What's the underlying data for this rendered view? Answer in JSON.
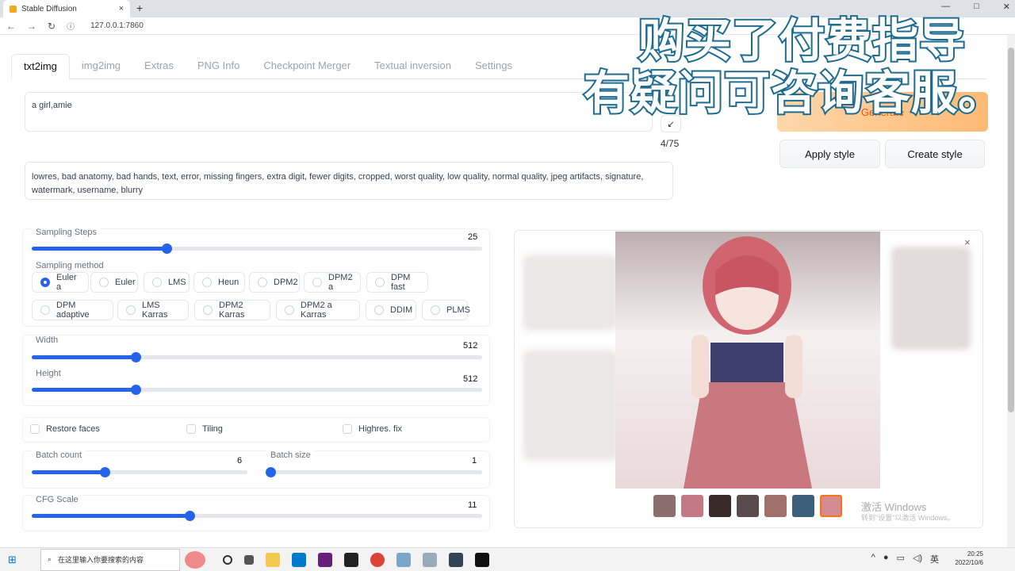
{
  "browser": {
    "tab_title": "Stable Diffusion",
    "url": "127.0.0.1:7860",
    "new_tab": "+",
    "close": "×"
  },
  "tabs": [
    "txt2img",
    "img2img",
    "Extras",
    "PNG Info",
    "Checkpoint Merger",
    "Textual inversion",
    "Settings"
  ],
  "prompt": {
    "text": "a girl,amie",
    "expand_icon": "↙",
    "token_count": "4/75"
  },
  "negative_prompt": "lowres, bad anatomy, bad hands, text, error, missing fingers, extra digit, fewer digits, cropped, worst quality, low quality, normal quality, jpeg artifacts, signature, watermark, username, blurry",
  "buttons": {
    "generate": "Generate",
    "apply_style": "Apply style",
    "create_style": "Create style"
  },
  "overlay": {
    "line1": "购买了付费指导",
    "line2": "有疑问可咨询客服。"
  },
  "sampling_steps": {
    "label": "Sampling Steps",
    "value": "25",
    "fraction": 0.3
  },
  "sampling_method": {
    "label": "Sampling method",
    "options": [
      "Euler a",
      "Euler",
      "LMS",
      "Heun",
      "DPM2",
      "DPM2 a",
      "DPM fast",
      "DPM adaptive",
      "LMS Karras",
      "DPM2 Karras",
      "DPM2 a Karras",
      "DDIM",
      "PLMS"
    ],
    "selected": "Euler a"
  },
  "width": {
    "label": "Width",
    "value": "512",
    "fraction": 0.23
  },
  "height": {
    "label": "Height",
    "value": "512",
    "fraction": 0.23
  },
  "checkboxes": {
    "restore_faces": "Restore faces",
    "tiling": "Tiling",
    "highres_fix": "Highres. fix"
  },
  "batch_count": {
    "label": "Batch count",
    "value": "6",
    "fraction": 0.34
  },
  "batch_size": {
    "label": "Batch size",
    "value": "1",
    "fraction": 0.0
  },
  "cfg_scale": {
    "label": "CFG Scale",
    "value": "11",
    "fraction": 0.35
  },
  "gallery": {
    "close_icon": "×"
  },
  "watermark": {
    "line1": "激活 Windows",
    "line2": "转到\"设置\"以激活 Windows。"
  },
  "taskbar": {
    "search_placeholder": "在这里输入你要搜索的内容",
    "time": "20:25",
    "date": "2022/10/6",
    "lang": "英"
  }
}
